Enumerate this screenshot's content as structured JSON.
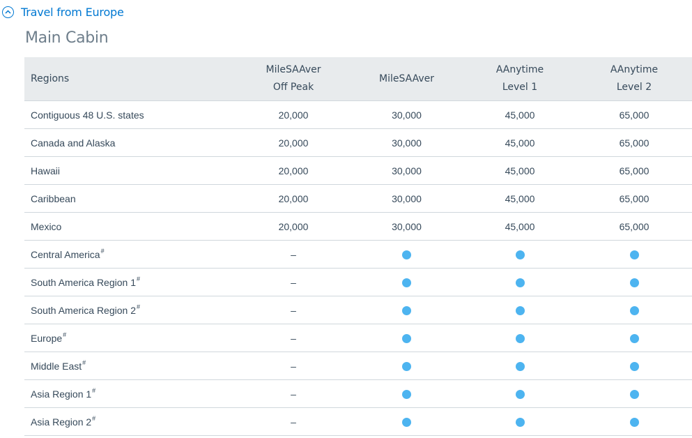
{
  "accordion": {
    "title": "Travel from Europe",
    "accent": "#0078d2"
  },
  "section": {
    "title": "Main Cabin"
  },
  "table": {
    "headers": {
      "region": "Regions",
      "c1_line1": "MileSAAver",
      "c1_line2": "Off Peak",
      "c2_line1": "MileSAAver",
      "c3_line1": "AAnytime",
      "c3_line2": "Level 1",
      "c4_line1": "AAnytime",
      "c4_line2": "Level 2"
    },
    "dash": "–",
    "note_mark": "#",
    "available_color": "#4db4f0",
    "rows": [
      {
        "region": "Contiguous 48 U.S. states",
        "note": "",
        "c1": "20,000",
        "c2": "30,000",
        "c3": "45,000",
        "c4": "65,000"
      },
      {
        "region": "Canada and Alaska",
        "note": "",
        "c1": "20,000",
        "c2": "30,000",
        "c3": "45,000",
        "c4": "65,000"
      },
      {
        "region": "Hawaii",
        "note": "",
        "c1": "20,000",
        "c2": "30,000",
        "c3": "45,000",
        "c4": "65,000"
      },
      {
        "region": "Caribbean",
        "note": "",
        "c1": "20,000",
        "c2": "30,000",
        "c3": "45,000",
        "c4": "65,000"
      },
      {
        "region": "Mexico",
        "note": "",
        "c1": "20,000",
        "c2": "30,000",
        "c3": "45,000",
        "c4": "65,000"
      },
      {
        "region": "Central America",
        "note": "#",
        "c1": "–",
        "c2": "dot",
        "c3": "dot",
        "c4": "dot"
      },
      {
        "region": "South America Region 1",
        "note": "#",
        "c1": "–",
        "c2": "dot",
        "c3": "dot",
        "c4": "dot"
      },
      {
        "region": "South America Region 2",
        "note": "#",
        "c1": "–",
        "c2": "dot",
        "c3": "dot",
        "c4": "dot"
      },
      {
        "region": "Europe",
        "note": "#",
        "c1": "–",
        "c2": "dot",
        "c3": "dot",
        "c4": "dot"
      },
      {
        "region": "Middle East",
        "note": "#",
        "c1": "–",
        "c2": "dot",
        "c3": "dot",
        "c4": "dot"
      },
      {
        "region": "Asia Region 1",
        "note": "#",
        "c1": "–",
        "c2": "dot",
        "c3": "dot",
        "c4": "dot"
      },
      {
        "region": "Asia Region 2",
        "note": "#",
        "c1": "–",
        "c2": "dot",
        "c3": "dot",
        "c4": "dot"
      }
    ]
  }
}
